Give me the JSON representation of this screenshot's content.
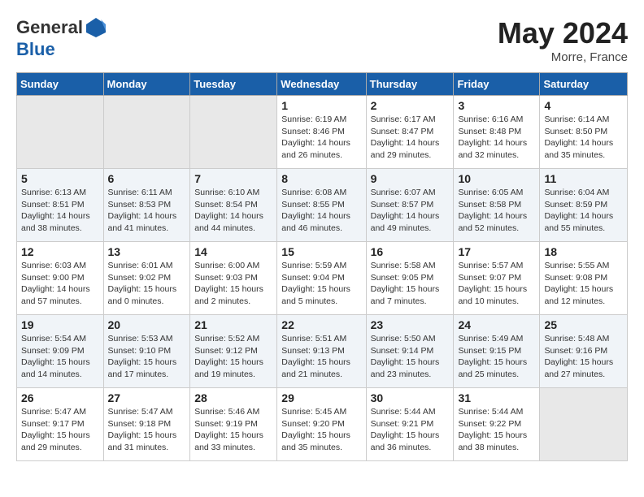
{
  "header": {
    "logo_general": "General",
    "logo_blue": "Blue",
    "month_year": "May 2024",
    "location": "Morre, France"
  },
  "weekdays": [
    "Sunday",
    "Monday",
    "Tuesday",
    "Wednesday",
    "Thursday",
    "Friday",
    "Saturday"
  ],
  "weeks": [
    [
      {
        "day": "",
        "empty": true
      },
      {
        "day": "",
        "empty": true
      },
      {
        "day": "",
        "empty": true
      },
      {
        "day": "1",
        "sunrise": "6:19 AM",
        "sunset": "8:46 PM",
        "daylight": "14 hours and 26 minutes."
      },
      {
        "day": "2",
        "sunrise": "6:17 AM",
        "sunset": "8:47 PM",
        "daylight": "14 hours and 29 minutes."
      },
      {
        "day": "3",
        "sunrise": "6:16 AM",
        "sunset": "8:48 PM",
        "daylight": "14 hours and 32 minutes."
      },
      {
        "day": "4",
        "sunrise": "6:14 AM",
        "sunset": "8:50 PM",
        "daylight": "14 hours and 35 minutes."
      }
    ],
    [
      {
        "day": "5",
        "sunrise": "6:13 AM",
        "sunset": "8:51 PM",
        "daylight": "14 hours and 38 minutes."
      },
      {
        "day": "6",
        "sunrise": "6:11 AM",
        "sunset": "8:53 PM",
        "daylight": "14 hours and 41 minutes."
      },
      {
        "day": "7",
        "sunrise": "6:10 AM",
        "sunset": "8:54 PM",
        "daylight": "14 hours and 44 minutes."
      },
      {
        "day": "8",
        "sunrise": "6:08 AM",
        "sunset": "8:55 PM",
        "daylight": "14 hours and 46 minutes."
      },
      {
        "day": "9",
        "sunrise": "6:07 AM",
        "sunset": "8:57 PM",
        "daylight": "14 hours and 49 minutes."
      },
      {
        "day": "10",
        "sunrise": "6:05 AM",
        "sunset": "8:58 PM",
        "daylight": "14 hours and 52 minutes."
      },
      {
        "day": "11",
        "sunrise": "6:04 AM",
        "sunset": "8:59 PM",
        "daylight": "14 hours and 55 minutes."
      }
    ],
    [
      {
        "day": "12",
        "sunrise": "6:03 AM",
        "sunset": "9:00 PM",
        "daylight": "14 hours and 57 minutes."
      },
      {
        "day": "13",
        "sunrise": "6:01 AM",
        "sunset": "9:02 PM",
        "daylight": "15 hours and 0 minutes."
      },
      {
        "day": "14",
        "sunrise": "6:00 AM",
        "sunset": "9:03 PM",
        "daylight": "15 hours and 2 minutes."
      },
      {
        "day": "15",
        "sunrise": "5:59 AM",
        "sunset": "9:04 PM",
        "daylight": "15 hours and 5 minutes."
      },
      {
        "day": "16",
        "sunrise": "5:58 AM",
        "sunset": "9:05 PM",
        "daylight": "15 hours and 7 minutes."
      },
      {
        "day": "17",
        "sunrise": "5:57 AM",
        "sunset": "9:07 PM",
        "daylight": "15 hours and 10 minutes."
      },
      {
        "day": "18",
        "sunrise": "5:55 AM",
        "sunset": "9:08 PM",
        "daylight": "15 hours and 12 minutes."
      }
    ],
    [
      {
        "day": "19",
        "sunrise": "5:54 AM",
        "sunset": "9:09 PM",
        "daylight": "15 hours and 14 minutes."
      },
      {
        "day": "20",
        "sunrise": "5:53 AM",
        "sunset": "9:10 PM",
        "daylight": "15 hours and 17 minutes."
      },
      {
        "day": "21",
        "sunrise": "5:52 AM",
        "sunset": "9:12 PM",
        "daylight": "15 hours and 19 minutes."
      },
      {
        "day": "22",
        "sunrise": "5:51 AM",
        "sunset": "9:13 PM",
        "daylight": "15 hours and 21 minutes."
      },
      {
        "day": "23",
        "sunrise": "5:50 AM",
        "sunset": "9:14 PM",
        "daylight": "15 hours and 23 minutes."
      },
      {
        "day": "24",
        "sunrise": "5:49 AM",
        "sunset": "9:15 PM",
        "daylight": "15 hours and 25 minutes."
      },
      {
        "day": "25",
        "sunrise": "5:48 AM",
        "sunset": "9:16 PM",
        "daylight": "15 hours and 27 minutes."
      }
    ],
    [
      {
        "day": "26",
        "sunrise": "5:47 AM",
        "sunset": "9:17 PM",
        "daylight": "15 hours and 29 minutes."
      },
      {
        "day": "27",
        "sunrise": "5:47 AM",
        "sunset": "9:18 PM",
        "daylight": "15 hours and 31 minutes."
      },
      {
        "day": "28",
        "sunrise": "5:46 AM",
        "sunset": "9:19 PM",
        "daylight": "15 hours and 33 minutes."
      },
      {
        "day": "29",
        "sunrise": "5:45 AM",
        "sunset": "9:20 PM",
        "daylight": "15 hours and 35 minutes."
      },
      {
        "day": "30",
        "sunrise": "5:44 AM",
        "sunset": "9:21 PM",
        "daylight": "15 hours and 36 minutes."
      },
      {
        "day": "31",
        "sunrise": "5:44 AM",
        "sunset": "9:22 PM",
        "daylight": "15 hours and 38 minutes."
      },
      {
        "day": "",
        "empty": true
      }
    ]
  ]
}
